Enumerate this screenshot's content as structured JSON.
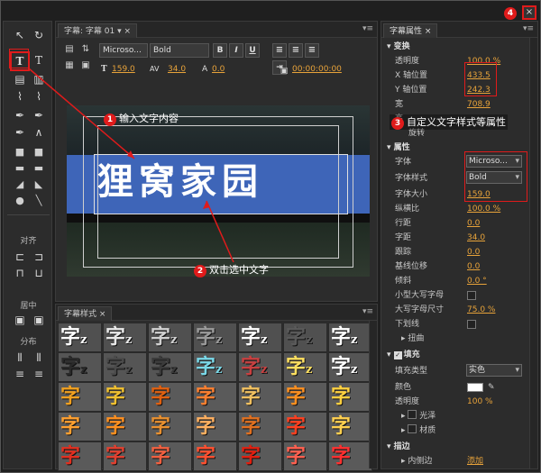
{
  "editor": {
    "tab_prefix": "字幕: 字幕 01",
    "font_family": "Microso...",
    "font_style": "Bold",
    "bold_label": "B",
    "italic_label": "I",
    "underline_label": "U",
    "font_size": "159.0",
    "kerning": "34.0",
    "leading": "0.0",
    "timecode": "00:00:00:00",
    "title_text": "狸窝家园"
  },
  "tools": {
    "align_label": "对齐",
    "center_label": "居中",
    "distribute_label": "分布"
  },
  "styles_panel": {
    "tab": "字幕样式",
    "swatch_char": "字",
    "swatch_small": "z",
    "rows": [
      [
        "#ffffff",
        "#e8e8e8",
        "#d0d0d0",
        "#9a9a9a",
        "#ffffff",
        "#5a5a5a",
        "#ffffff"
      ],
      [
        "#2a2a2a",
        "#4a4a4a",
        "#3a3a3a",
        "#7ad8e8",
        "#c84040",
        "#ffe060",
        "#ffffff"
      ],
      [
        "#f0a020",
        "#f0c030",
        "#e06010",
        "#ff8030",
        "#f0c060",
        "#ff9020",
        "#ffd040"
      ],
      [
        "#ffa030",
        "#ff9020",
        "#e89030",
        "#ffb060",
        "#e07020",
        "#ff4020",
        "#ffd050"
      ],
      [
        "#e03020",
        "#e04030",
        "#f06040",
        "#ff5030",
        "#e02010",
        "#ff6050",
        "#ff3030"
      ]
    ]
  },
  "props": {
    "tab": "字幕属性",
    "transform": "变换",
    "opacity_label": "透明度",
    "opacity": "100.0 %",
    "x_label": "X 轴位置",
    "x": "433.5",
    "y_label": "Y 轴位置",
    "y": "242.3",
    "width_label": "宽",
    "width": "708.9",
    "height_label": "高",
    "rotation_label": "旋转",
    "properties": "属性",
    "font_label": "字体",
    "font": "Microso...",
    "style_label": "字体样式",
    "style": "Bold",
    "size_label": "字体大小",
    "size": "159.0",
    "aspect_label": "纵横比",
    "aspect": "100.0 %",
    "leading_label": "行距",
    "leading": "0.0",
    "kerning_label": "字距",
    "kerning": "34.0",
    "tracking_label": "跟踪",
    "tracking": "0.0",
    "baseline_label": "基线位移",
    "baseline": "0.0",
    "slant_label": "倾斜",
    "slant": "0.0 °",
    "smallcaps_label": "小型大写字母",
    "smallcaps_size_label": "大写字母尺寸",
    "smallcaps_size": "75.0 %",
    "underline_label": "下划线",
    "distort_label": "扭曲",
    "fill_label": "填充",
    "fill_type_label": "填充类型",
    "fill_type": "实色",
    "color_label": "颜色",
    "fill_opacity_label": "透明度",
    "fill_opacity": "100 %",
    "sheen_label": "光泽",
    "texture_label": "材质",
    "stroke_label": "描边",
    "inner_stroke_label": "内侧边",
    "add_label": "添加"
  },
  "annotations": {
    "a1": "输入文字内容",
    "a2": "双击选中文字",
    "a3": "自定义文字样式等属性",
    "n1": "1",
    "n2": "2",
    "n3": "3",
    "n4": "4"
  },
  "window": {
    "close": "×"
  },
  "colors": {
    "accent": "#e8a33a",
    "annotation_red": "#e01b1b",
    "band_blue": "#3e65b8"
  }
}
